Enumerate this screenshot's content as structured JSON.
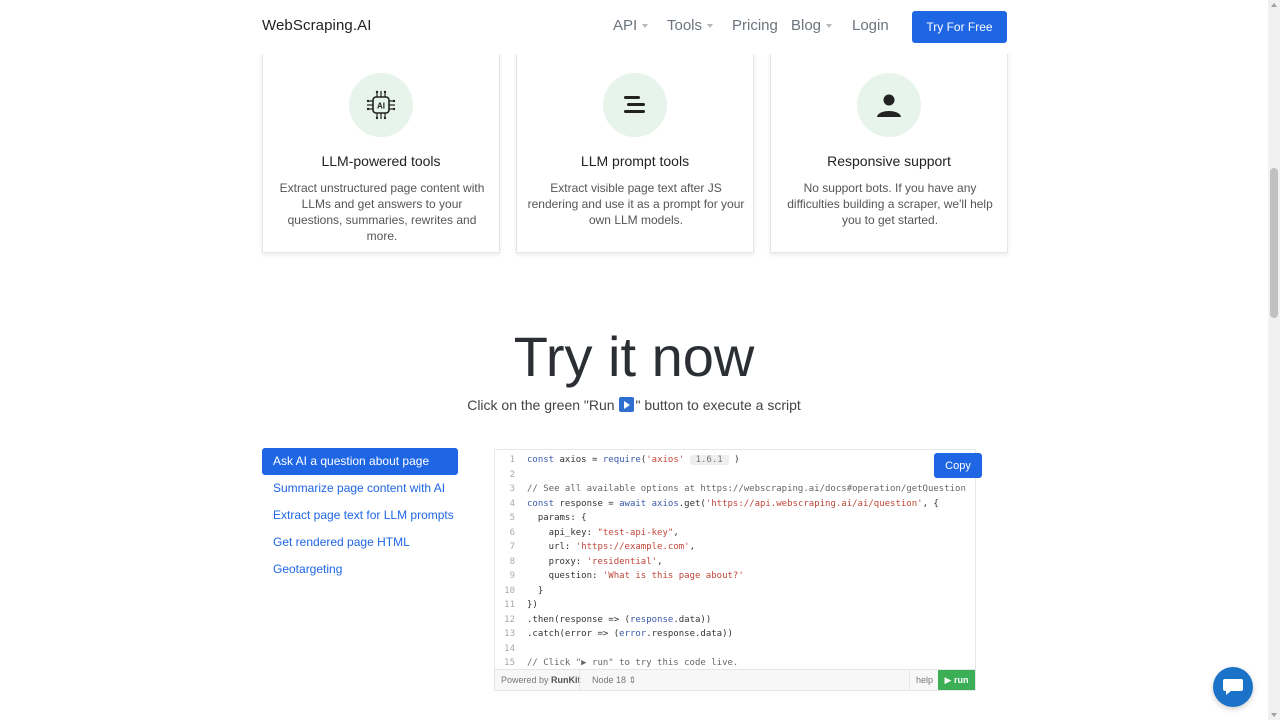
{
  "nav": {
    "brand": "WebScraping.AI",
    "items": [
      "API",
      "Tools",
      "Pricing",
      "Blog",
      "Login"
    ],
    "cta": "Try For Free"
  },
  "features": [
    {
      "title": "LLM-powered tools",
      "text": "Extract unstructured page content with LLMs and get answers to your questions, summaries, rewrites and more.",
      "icon": "ai-chip-icon"
    },
    {
      "title": "LLM prompt tools",
      "text": "Extract visible page text after JS rendering and use it as a prompt for your own LLM models.",
      "icon": "text-lines-icon"
    },
    {
      "title": "Responsive support",
      "text": "No support bots. If you have any difficulties building a scraper, we'll help you to get started.",
      "icon": "person-icon"
    }
  ],
  "try_section": {
    "title": "Try it now",
    "subtitle_before": "Click on the green \"Run ",
    "subtitle_after": "\" button to execute a script"
  },
  "examples": [
    "Ask AI a question about page",
    "Summarize page content with AI",
    "Extract page text for LLM prompts",
    "Get rendered page HTML",
    "Geotargeting"
  ],
  "code": {
    "copy_label": "Copy",
    "axios_version": "1.6.1",
    "comment_options": "// See all available options at https://webscraping.ai/docs#operation/getQuestion",
    "endpoint": "'https://api.webscraping.ai/ai/question'",
    "api_key": "\"test-api-key\"",
    "url": "'https://example.com'",
    "proxy": "'residential'",
    "question": "'What is this page about?'",
    "comment_run": "// Click \"▶ run\" to try this code live.",
    "powered_by": "Powered by",
    "runkit": "RunKit",
    "node": "Node 18",
    "help": "help",
    "run": "▶ run"
  },
  "colors": {
    "accent": "#1f66e5",
    "run_green": "#3cae55",
    "icon_bg": "#e7f4ec"
  }
}
